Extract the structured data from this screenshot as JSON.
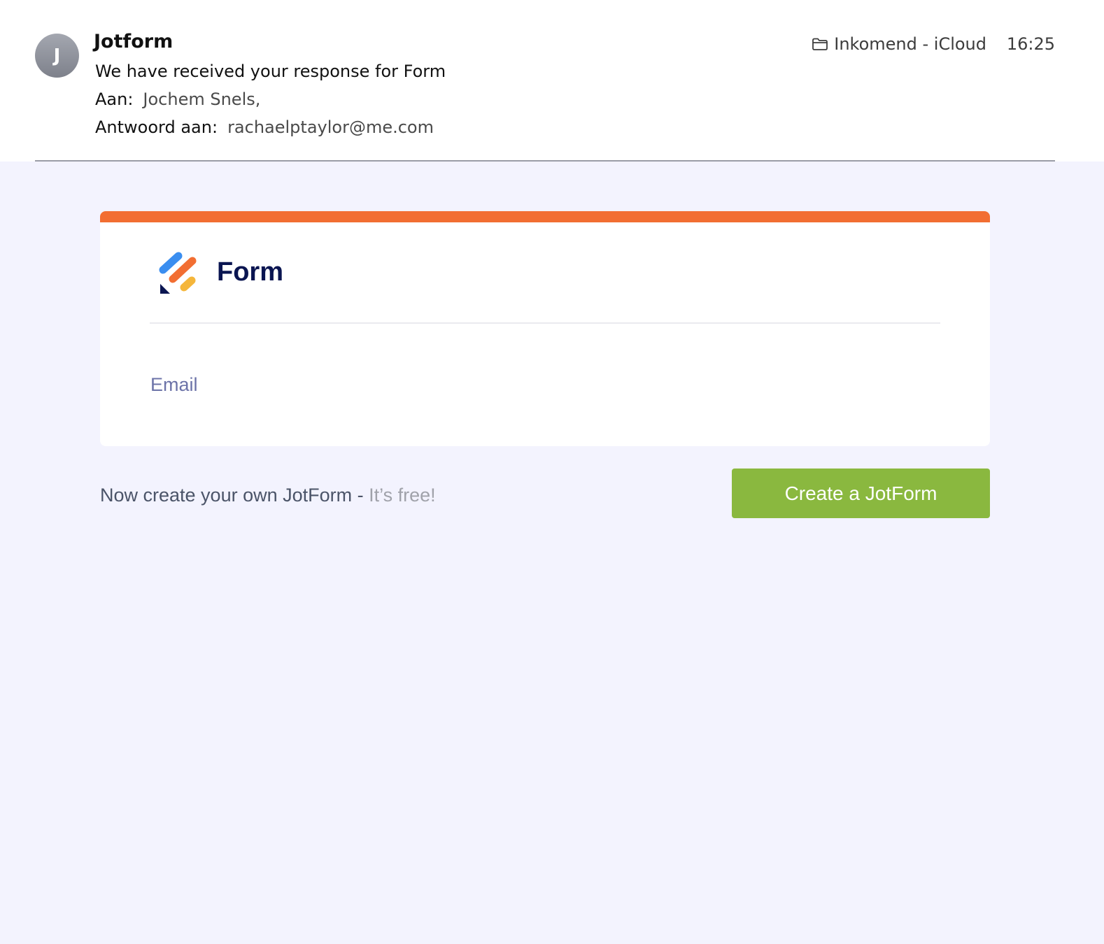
{
  "email": {
    "avatar_initial": "J",
    "sender": "Jotform",
    "subject": "We have received your response for Form",
    "to_label": "Aan:",
    "to_value": "Jochem Snels,",
    "reply_to_label": "Antwoord aan:",
    "reply_to_value": "rachaelptaylor@me.com",
    "mailbox_icon": "folder-icon",
    "mailbox": "Inkomend - iCloud",
    "time": "16:25"
  },
  "card": {
    "logo_icon": "jotform-logo-icon",
    "title": "Form",
    "field_label": "Email"
  },
  "footer": {
    "text": "Now create your own JotForm - ",
    "highlight": "It’s free!",
    "button_label": "Create a JotForm"
  },
  "colors": {
    "accent_bar": "#f26e32",
    "cta_green": "#8ab83f",
    "body_background": "#f3f3fe",
    "title_navy": "#0a1551"
  }
}
